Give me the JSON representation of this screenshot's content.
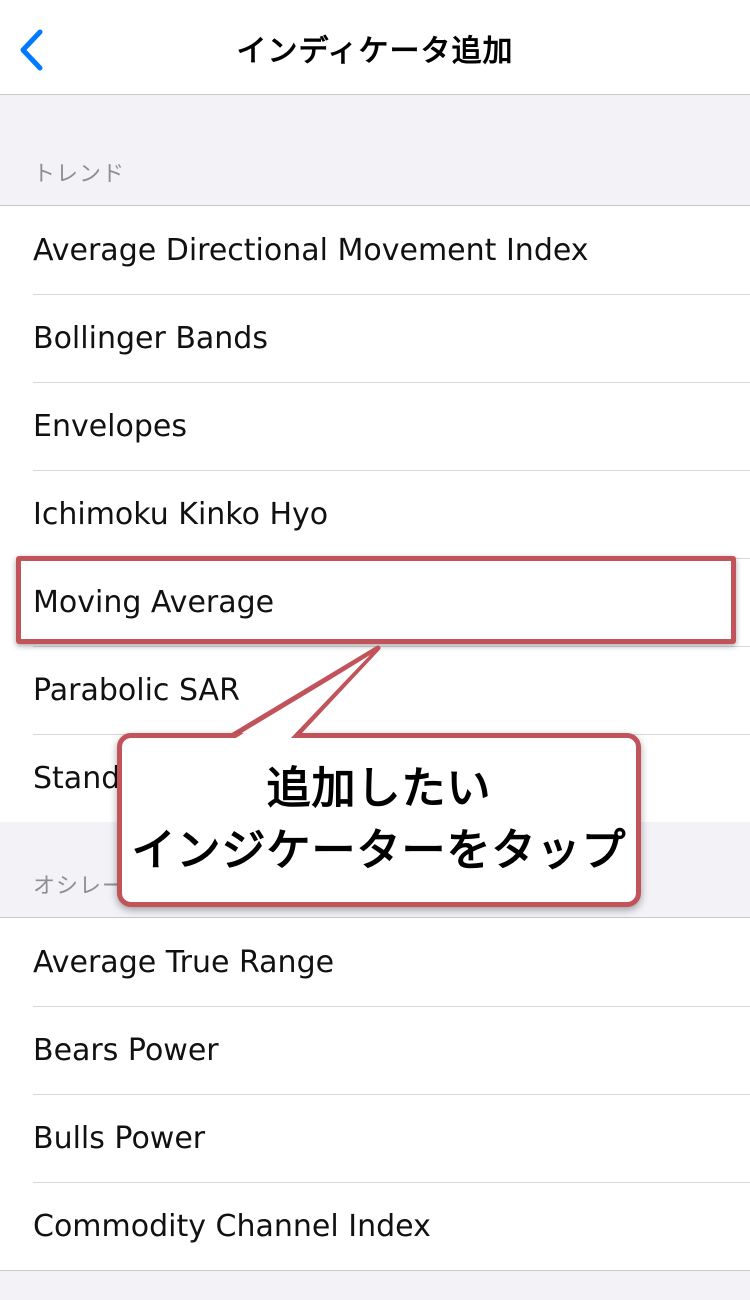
{
  "nav": {
    "title": "インディケータ追加",
    "back_icon": "chevron-left-icon"
  },
  "sections": [
    {
      "header": "トレンド",
      "items": [
        "Average Directional Movement Index",
        "Bollinger Bands",
        "Envelopes",
        "Ichimoku Kinko Hyo",
        "Moving Average",
        "Parabolic SAR",
        "Stand"
      ]
    },
    {
      "header": "オシレー",
      "items": [
        "Average True Range",
        "Bears Power",
        "Bulls Power",
        "Commodity Channel Index"
      ]
    }
  ],
  "callout": {
    "line1": "追加したい",
    "line2": "インジケーターをタップ"
  },
  "colors": {
    "accent": "#007aff",
    "annotation": "#c0545a",
    "background": "#f2f2f7"
  }
}
